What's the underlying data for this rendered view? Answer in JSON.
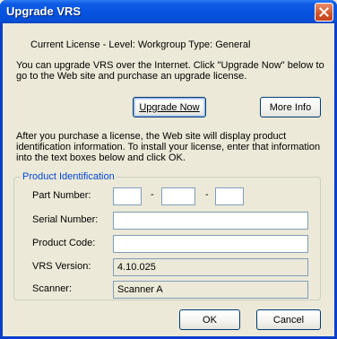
{
  "window": {
    "title": "Upgrade VRS"
  },
  "license_line": "Current License - Level: Workgroup  Type: General",
  "intro_text": "You can upgrade VRS over the Internet. Click \"Upgrade Now\" below to go to the Web site and purchase an upgrade license.",
  "buttons": {
    "upgrade_now": "Upgrade Now",
    "more_info": "More Info",
    "ok": "OK",
    "cancel": "Cancel"
  },
  "instructions_text": "After you purchase a license, the Web site will display product identification information.  To install your license, enter that information into the text boxes below and click OK.",
  "product_identification": {
    "legend": "Product Identification",
    "part_number_label": "Part Number:",
    "part_separator": "-",
    "part1": "",
    "part2": "",
    "part3": "",
    "serial_number_label": "Serial Number:",
    "serial_number": "",
    "product_code_label": "Product Code:",
    "product_code": "",
    "vrs_version_label": "VRS Version:",
    "vrs_version": "4.10.025",
    "scanner_label": "Scanner:",
    "scanner": "Scanner A"
  },
  "icons": {
    "close": "close-icon"
  },
  "colors": {
    "titlebar": "#0553e0",
    "close": "#d1542b",
    "legend": "#0046d5"
  }
}
